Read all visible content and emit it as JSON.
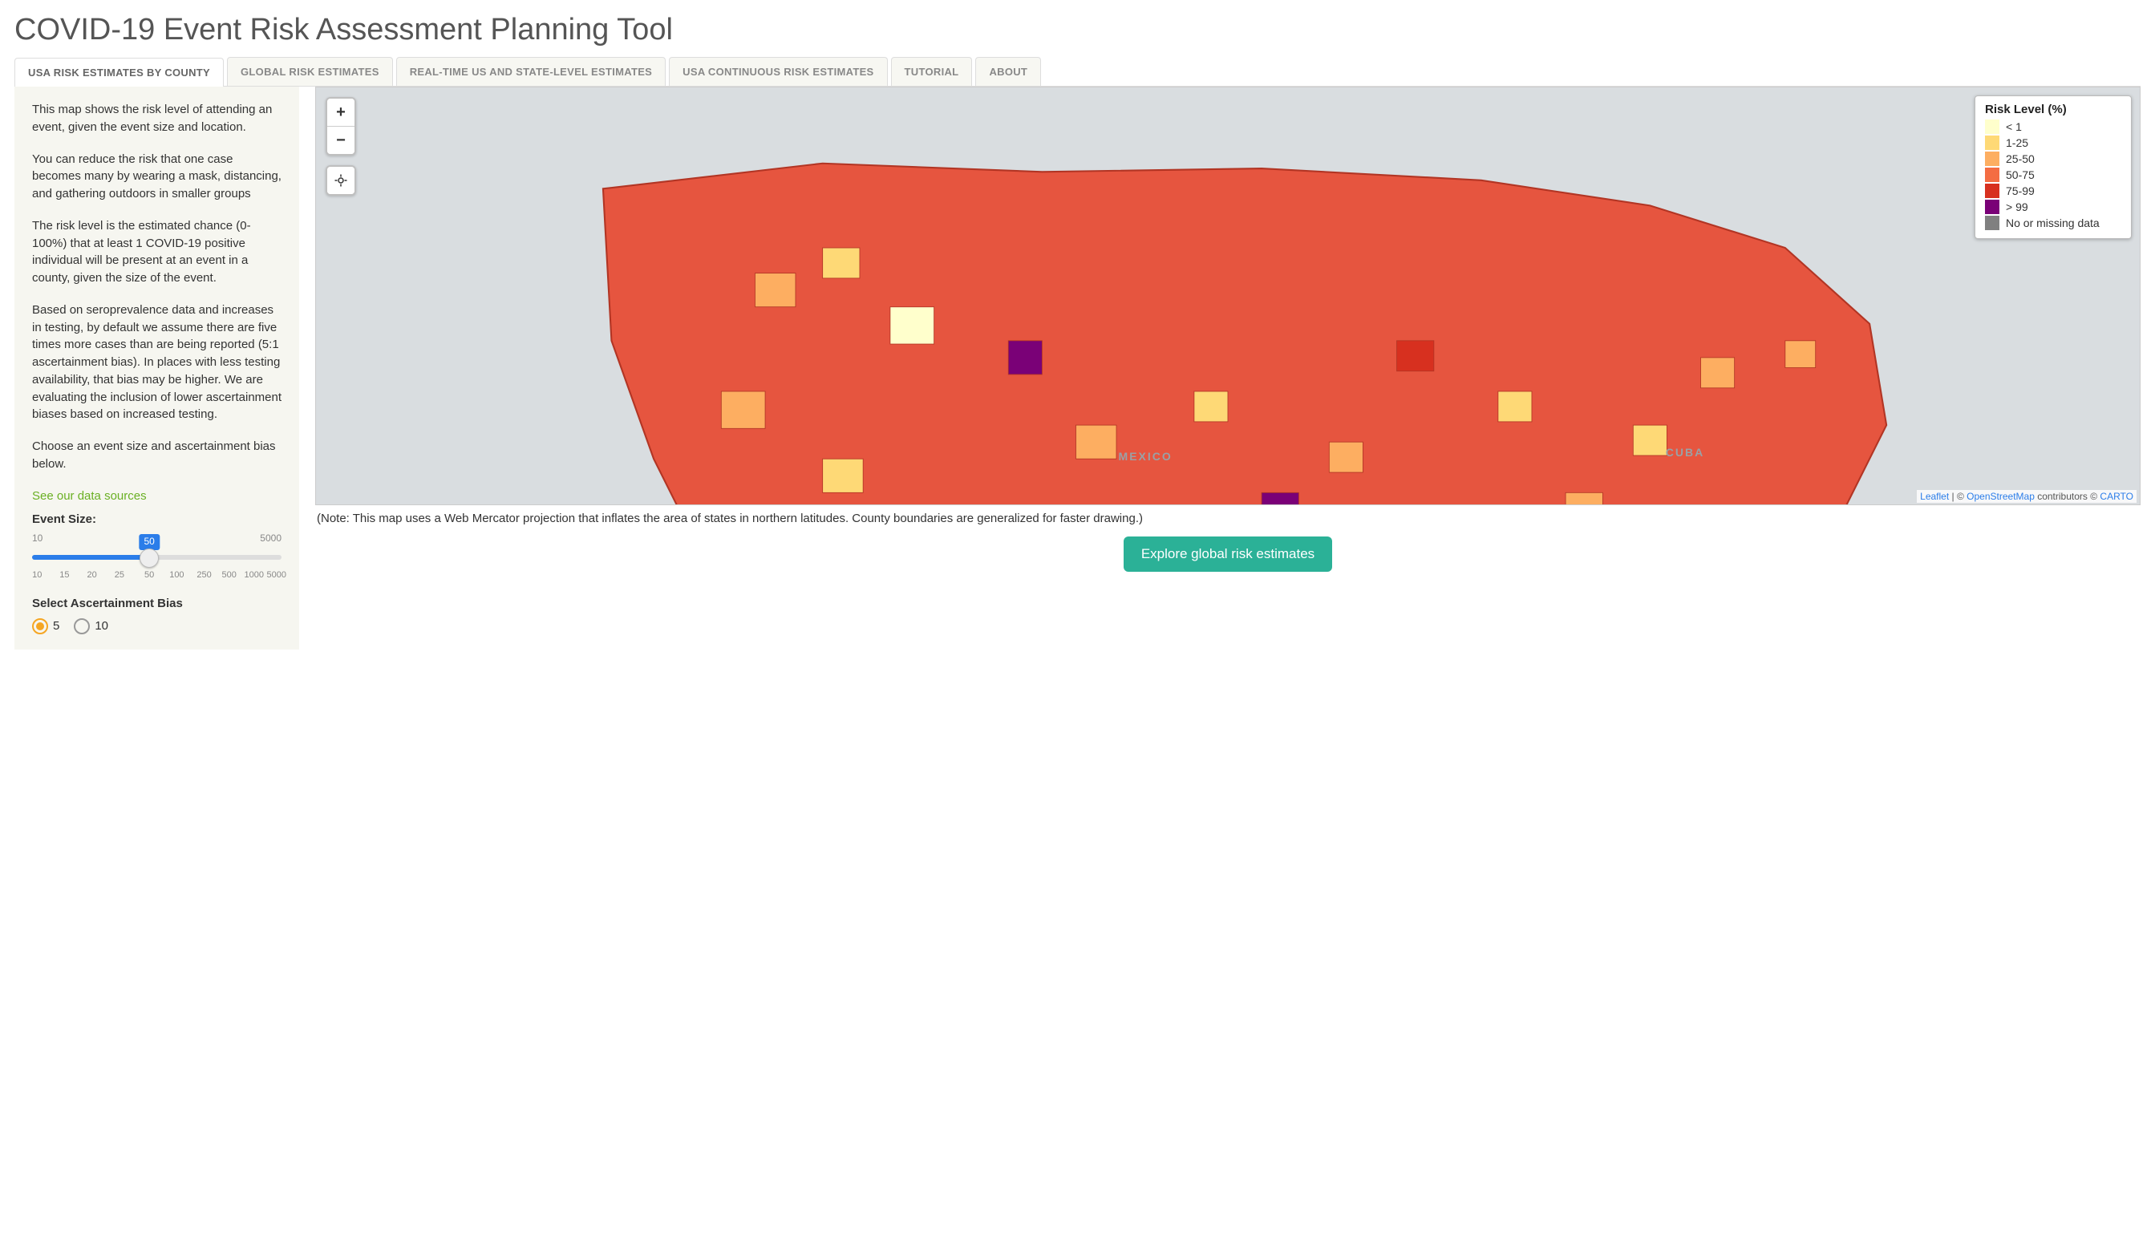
{
  "title": "COVID-19 Event Risk Assessment Planning Tool",
  "tabs": [
    {
      "label": "USA RISK ESTIMATES BY COUNTY",
      "active": true
    },
    {
      "label": "GLOBAL RISK ESTIMATES"
    },
    {
      "label": "REAL-TIME US AND STATE-LEVEL ESTIMATES"
    },
    {
      "label": "USA CONTINUOUS RISK ESTIMATES"
    },
    {
      "label": "TUTORIAL"
    },
    {
      "label": "ABOUT"
    }
  ],
  "sidebar": {
    "p1": "This map shows the risk level of attending an event, given the event size and location.",
    "p2": "You can reduce the risk that one case becomes many by wearing a mask, distancing, and gathering outdoors in smaller groups",
    "p3": "The risk level is the estimated chance (0-100%) that at least 1 COVID-19 positive individual will be present at an event in a county, given the size of the event.",
    "p4": "Based on seroprevalence data and increases in testing, by default we assume there are five times more cases than are being reported (5:1 ascertainment bias). In places with less testing availability, that bias may be higher. We are evaluating the inclusion of lower ascertainment biases based on increased testing.",
    "p5": "Choose an event size and ascertainment bias below.",
    "data_sources_link": "See our data sources",
    "event_size_label": "Event Size:",
    "slider": {
      "min": "10",
      "max": "5000",
      "value": "50",
      "ticks": [
        "10",
        "15",
        "20",
        "25",
        "50",
        "100",
        "250",
        "500",
        "1000",
        "5000"
      ]
    },
    "bias_label": "Select Ascertainment Bias",
    "bias_options": [
      {
        "label": "5",
        "selected": true
      },
      {
        "label": "10",
        "selected": false
      }
    ]
  },
  "map": {
    "zoom_in": "+",
    "zoom_out": "−",
    "legend_title": "Risk Level (%)",
    "legend": [
      {
        "color": "#ffffcc",
        "label": "< 1"
      },
      {
        "color": "#fed976",
        "label": "1-25"
      },
      {
        "color": "#fdae61",
        "label": "25-50"
      },
      {
        "color": "#f46d43",
        "label": "50-75"
      },
      {
        "color": "#d7301f",
        "label": "75-99"
      },
      {
        "color": "#7a0177",
        "label": "> 99"
      },
      {
        "color": "#808080",
        "label": "No or missing data"
      }
    ],
    "labels": {
      "mexico": "MEXICO",
      "cuba": "CUBA"
    },
    "attribution": {
      "leaflet": "Leaflet",
      "sep1": " | © ",
      "osm": "OpenStreetMap",
      "sep2": " contributors © ",
      "carto": "CARTO"
    },
    "note": "(Note: This map uses a Web Mercator projection that inflates the area of states in northern latitudes. County boundaries are generalized for faster drawing.)",
    "explore_btn": "Explore global risk estimates"
  }
}
